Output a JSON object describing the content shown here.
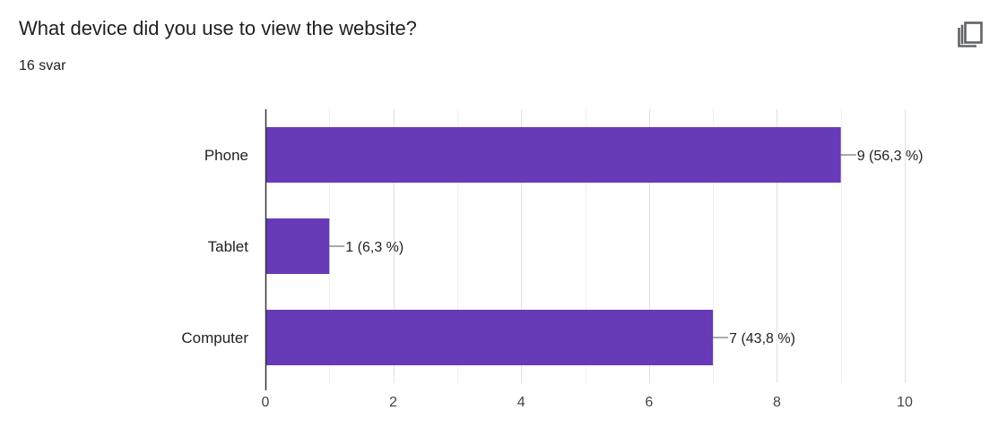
{
  "question": {
    "title": "What device did you use to view the website?",
    "response_count": "16 svar"
  },
  "actions": {
    "copy_icon": "copy-icon"
  },
  "colors": {
    "bar": "#673ab7",
    "grid": "#e8e8e8",
    "axis": "#333333",
    "text": "#222222"
  },
  "chart_data": {
    "type": "bar",
    "orientation": "horizontal",
    "categories": [
      "Phone",
      "Tablet",
      "Computer"
    ],
    "values": [
      9,
      1,
      7
    ],
    "data_labels": [
      "9 (56,3 %)",
      "1 (6,3 %)",
      "7 (43,8 %)"
    ],
    "xlim": [
      0,
      10
    ],
    "xticks": [
      0,
      2,
      4,
      6,
      8,
      10
    ],
    "grid": true,
    "legend": "none"
  }
}
